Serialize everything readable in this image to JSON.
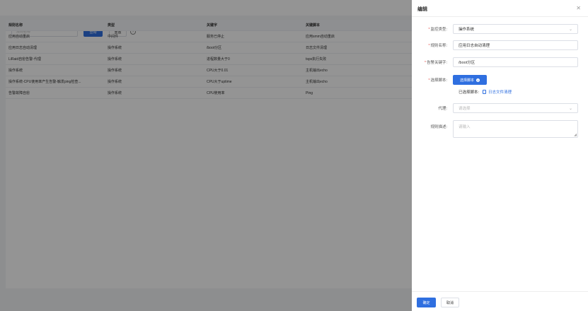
{
  "toolbar": {
    "search_placeholder": "规则名称",
    "query_label": "查询",
    "reset_label": "重置",
    "help_icon": "question-circle-icon"
  },
  "table": {
    "headers": [
      "规则名称",
      "类型",
      "关键字",
      "关键脚本",
      ""
    ],
    "rows": [
      [
        "应用自动重启",
        "中间件",
        "服务已停止",
        "应用smm自动重启",
        ""
      ],
      [
        "应用日志自动清理",
        "操作系统",
        "/boot分区",
        "日志文件清理",
        ""
      ],
      [
        "LiRaid自愈告警-代理",
        "操作系统",
        "进程数量大于0",
        "tsps执行失败",
        ""
      ],
      [
        "操作系统",
        "操作系统",
        "CPU大于0.01",
        "主机输出echo",
        ""
      ],
      [
        "操作系统-CPU使用率产生告警-触发ping检查...",
        "操作系统",
        "CPU大于uptime",
        "主机输出echo",
        ""
      ],
      [
        "告警故障自愈",
        "操作系统",
        "CPU使用率",
        "Ping",
        ""
      ]
    ]
  },
  "drawer": {
    "title": "编辑",
    "monitor_type_label": "监控类型:",
    "monitor_type_value": "操作系统",
    "rule_name_label": "规则名称:",
    "rule_name_value": "应用日志自动清理",
    "alarm_keyword_label": "告警关键字:",
    "alarm_keyword_value": "/boot分区",
    "select_script_label": "选择脚本:",
    "select_script_button": "选择脚本",
    "selected_script_label": "已选择脚本:",
    "selected_script_name": "日志文件清理",
    "proxy_label": "代理:",
    "proxy_placeholder": "请选择",
    "rule_desc_label": "规则描述:",
    "rule_desc_placeholder": "请输入",
    "confirm_label": "确定",
    "cancel_label": "取消"
  },
  "colors": {
    "primary": "#2f6fe0",
    "required": "#e6544f",
    "overlay": "rgba(0,0,0,0.42)"
  }
}
